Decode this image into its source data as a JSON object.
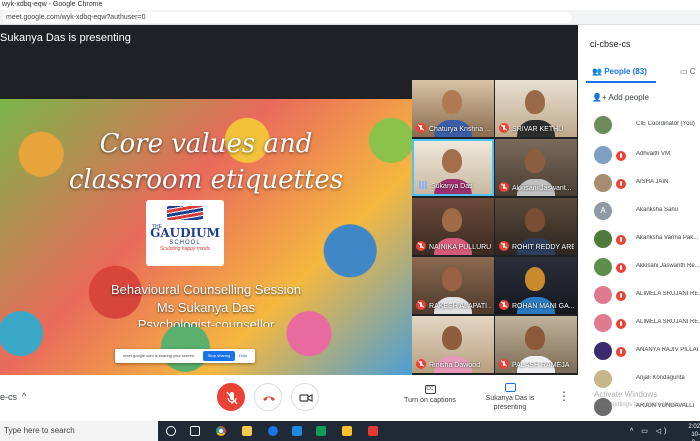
{
  "browser": {
    "title": "wyk-xdbq-eqw - Google Chrome",
    "url": "meet.google.com/wyk-xdbq-eqw?authuser=0"
  },
  "stage": {
    "presenting_label": "Sukanya Das is presenting"
  },
  "slide": {
    "title_line1": "Core values and",
    "title_line2": "classroom etiquettes",
    "logo_the": "THE",
    "logo_name": "GAUDIUM",
    "logo_school": "SCHOOL",
    "logo_tagline": "Sculpting happy minds",
    "line1": "Behavioural Counselling Session",
    "line2": "Ms Sukanya Das",
    "line3": "Psychologist-counsellor"
  },
  "share_bar": {
    "message": "meet.google.com is sharing your screen.",
    "stop_label": "Stop sharing",
    "hide_label": "Hide"
  },
  "tiles": [
    {
      "name": "Chaturya Krishna ...",
      "state": "muted"
    },
    {
      "name": "SRIVAR KETHU",
      "state": "muted"
    },
    {
      "name": "Sukanya Das",
      "state": "speaking"
    },
    {
      "name": "Akkisani Jaswant...",
      "state": "muted"
    },
    {
      "name": "NAINIKA PULLURU",
      "state": "muted"
    },
    {
      "name": "ROHIT REDDY ARE",
      "state": "muted"
    },
    {
      "name": "RAKESH ALAPATI ...",
      "state": "muted"
    },
    {
      "name": "ROHAN MANI GA...",
      "state": "muted"
    },
    {
      "name": "Rinisha Dawood",
      "state": "muted"
    },
    {
      "name": "PALASH RAMEJA",
      "state": "muted"
    }
  ],
  "callbar": {
    "meeting_code": "e-cs",
    "chevron": "^",
    "captions_label": "Turn on captions",
    "presenting_label_1": "Sukanya Das is",
    "presenting_label_2": "presenting",
    "more": "⋮"
  },
  "panel": {
    "room_name": "ci-cbse-cs",
    "tab_people": "People (83)",
    "tab_chat": "C",
    "add_people": "Add people",
    "people": [
      {
        "name": "CIE Coordinator (You)",
        "initial": ""
      },
      {
        "name": "Adhvaith VM",
        "initial": ""
      },
      {
        "name": "AISHA JAIN",
        "initial": ""
      },
      {
        "name": "Akanksha Sahu",
        "initial": "A"
      },
      {
        "name": "Akanksha Varma Pak...",
        "initial": ""
      },
      {
        "name": "Akkisani Jaswanth Re...",
        "initial": ""
      },
      {
        "name": "ALIMELA SRUJANI RE...",
        "initial": ""
      },
      {
        "name": "ALIMELA SRUJANI RE...",
        "initial": ""
      },
      {
        "name": "ANANYA RAJIV PILLAI",
        "initial": ""
      },
      {
        "name": "Anjali Kondagunta",
        "initial": ""
      },
      {
        "name": "ARJUN VUNDAVALLI",
        "initial": ""
      }
    ],
    "activate_line1": "Activate Windows",
    "activate_line2": "Go to Settings to activate Windows."
  },
  "taskbar": {
    "search_placeholder": "Type here to search",
    "time": "2:02",
    "date": "10-0..."
  },
  "colors": {
    "meet_dark": "#202124",
    "mute_red": "#ea4335",
    "accent_blue": "#1a73e8"
  }
}
